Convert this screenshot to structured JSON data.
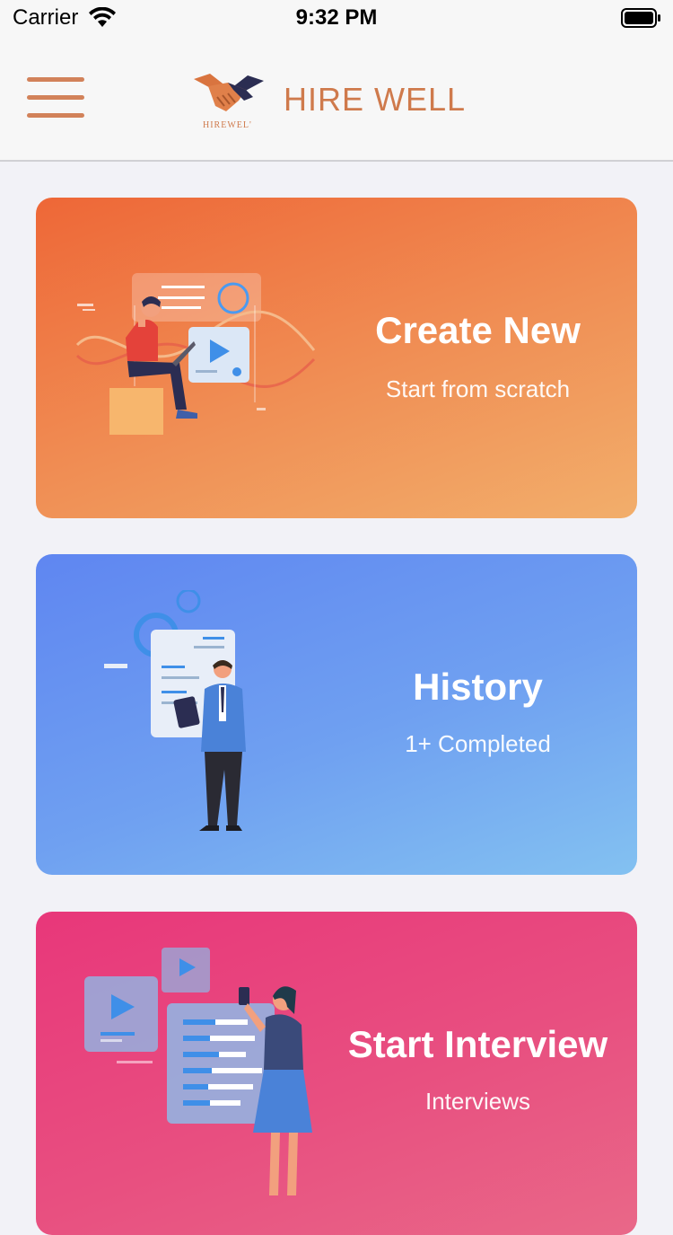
{
  "status_bar": {
    "carrier": "Carrier",
    "time": "9:32 PM"
  },
  "header": {
    "brand": "HIRE WELL",
    "logo_text": "HIREWELL"
  },
  "cards": [
    {
      "title": "Create New",
      "subtitle": "Start from scratch"
    },
    {
      "title": "History",
      "subtitle": "1+ Completed"
    },
    {
      "title": "Start Interview",
      "subtitle": "Interviews"
    }
  ],
  "colors": {
    "brand": "#cf7a4c",
    "create_card": "#ee6737",
    "history_card": "#5f86f1",
    "interview_card": "#e8377a"
  }
}
